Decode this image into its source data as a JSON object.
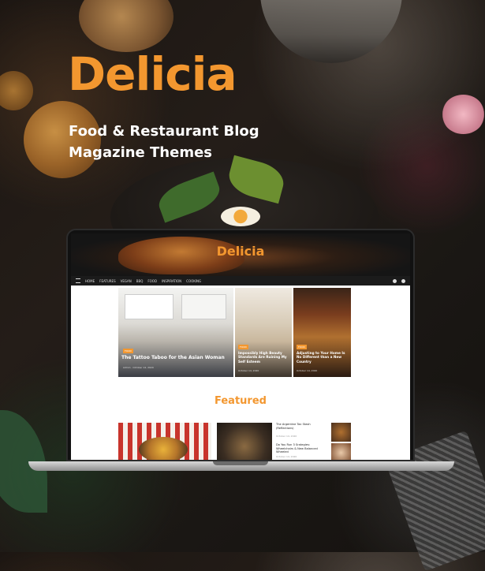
{
  "hero": {
    "brand": "Delicia",
    "tagline_line1": "Food & Restaurant Blog",
    "tagline_line2": "Magazine Themes"
  },
  "colors": {
    "accent": "#f3972f",
    "nav_bg": "#1b1b1b"
  },
  "preview": {
    "logo": "Delicia",
    "nav": [
      "HOME",
      "FEATURES",
      "VEGAN",
      "BBQ",
      "FOOD",
      "INSPIRATION",
      "COOKING"
    ],
    "nav_icons": [
      "menu-icon",
      "user-icon",
      "search-icon"
    ],
    "cards": [
      {
        "tag": "FOOD",
        "title": "The Tattoo Taboo for the Asian Woman",
        "meta": "Admin  ·  October 14, 2020"
      },
      {
        "tag": "FOOD",
        "title": "Impossibly High Beauty Standards Are Ruining My Self Esteem",
        "meta": "October 14, 2020"
      },
      {
        "tag": "FOOD",
        "title": "Adjusting to Your Home Is No Different than a New Country",
        "meta": "October 14, 2020"
      }
    ],
    "featured_heading": "Featured",
    "list": [
      {
        "title": "The Argentine Tax Stash (Reflections)",
        "meta": "October 14, 2020"
      },
      {
        "title": "Do You Run 3 Srategies: Wheelchairs & New Balanced Wheeled",
        "meta": "October 14, 2020"
      }
    ]
  }
}
